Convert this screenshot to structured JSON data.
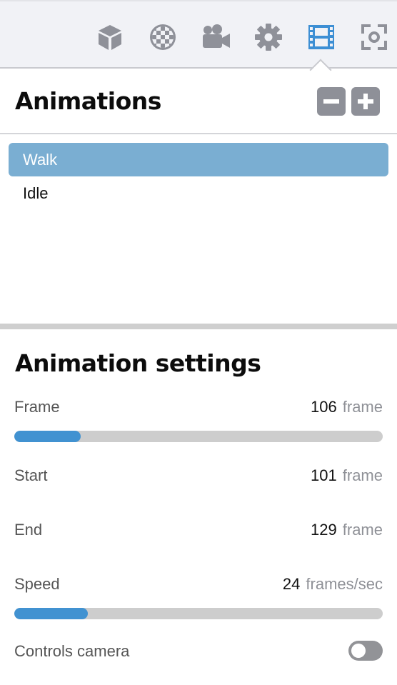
{
  "toolbar": {
    "icons": [
      "cube-icon",
      "texture-icon",
      "camera-icon",
      "settings-icon",
      "film-icon",
      "focus-icon"
    ],
    "active_index": 4,
    "colors": {
      "inactive": "#8f9199",
      "active": "#3d8fd4"
    }
  },
  "animations": {
    "title": "Animations",
    "remove_icon": "minus-icon",
    "add_icon": "plus-icon",
    "items": [
      {
        "label": "Walk",
        "selected": true
      },
      {
        "label": "Idle",
        "selected": false
      }
    ],
    "selected_color": "#7aaed2"
  },
  "settings": {
    "title": "Animation settings",
    "frame": {
      "label": "Frame",
      "value": "106",
      "unit": "frame",
      "fill_fraction": 0.18
    },
    "start": {
      "label": "Start",
      "value": "101",
      "unit": "frame"
    },
    "end": {
      "label": "End",
      "value": "129",
      "unit": "frame"
    },
    "speed": {
      "label": "Speed",
      "value": "24",
      "unit": "frames/sec",
      "fill_fraction": 0.2
    },
    "controls_camera": {
      "label": "Controls camera",
      "on": false
    },
    "accent": "#4192d1"
  }
}
